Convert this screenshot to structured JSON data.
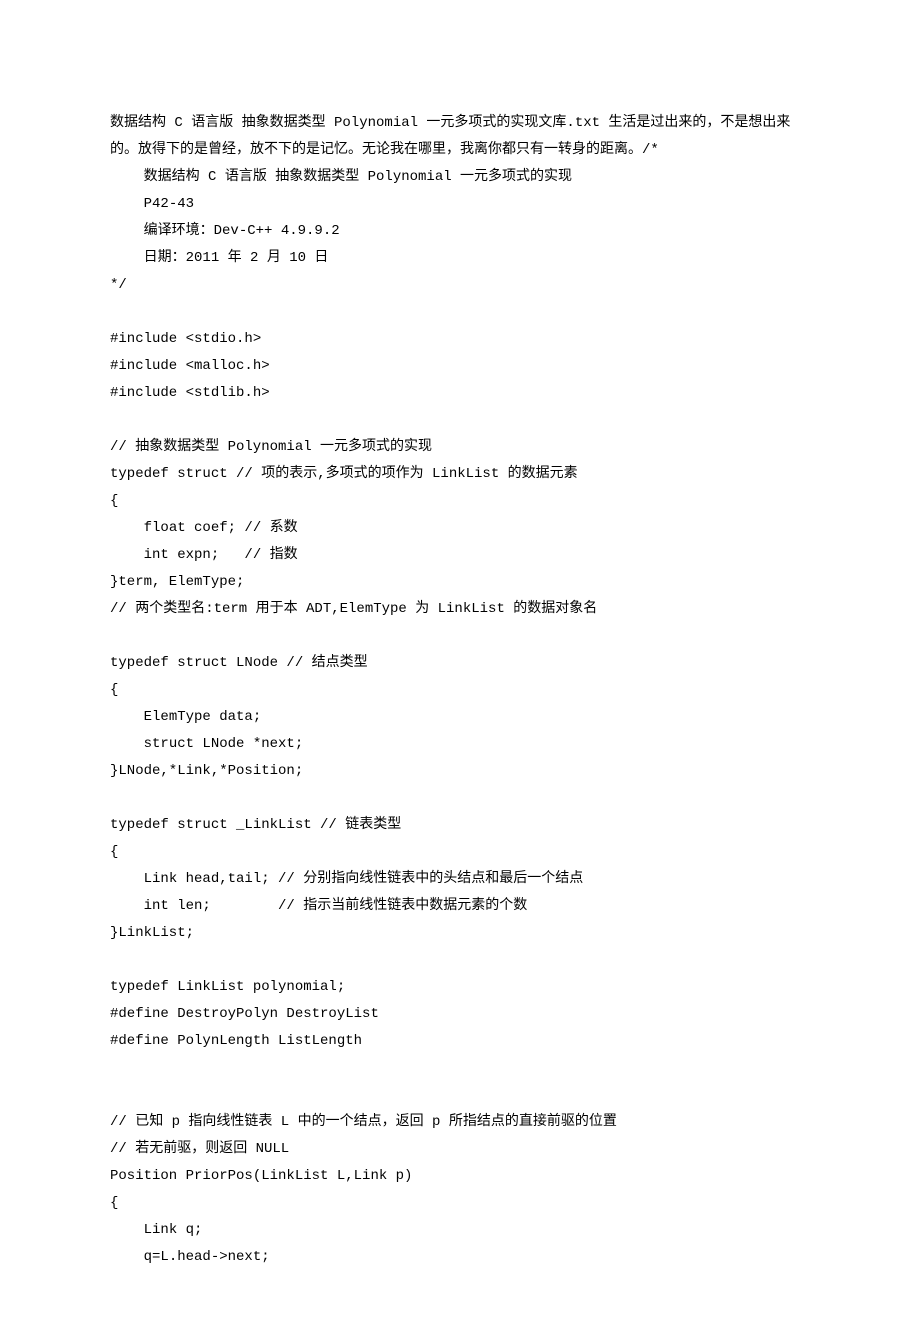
{
  "lines": [
    "数据结构 C 语言版 抽象数据类型 Polynomial 一元多项式的实现文库.txt 生活是过出来的，不是想出来的。放得下的是曾经，放不下的是记忆。无论我在哪里，我离你都只有一转身的距离。/*",
    "    数据结构 C 语言版 抽象数据类型 Polynomial 一元多项式的实现",
    "    P42-43",
    "    编译环境：Dev-C++ 4.9.9.2",
    "    日期：2011 年 2 月 10 日",
    "*/",
    "",
    "#include <stdio.h>",
    "#include <malloc.h>",
    "#include <stdlib.h>",
    "",
    "// 抽象数据类型 Polynomial 一元多项式的实现",
    "typedef struct // 项的表示,多项式的项作为 LinkList 的数据元素",
    "{",
    "    float coef; // 系数",
    "    int expn;   // 指数",
    "}term, ElemType;",
    "// 两个类型名:term 用于本 ADT,ElemType 为 LinkList 的数据对象名",
    "",
    "typedef struct LNode // 结点类型",
    "{",
    "    ElemType data;",
    "    struct LNode *next;",
    "}LNode,*Link,*Position;",
    "",
    "typedef struct _LinkList // 链表类型",
    "{",
    "    Link head,tail; // 分别指向线性链表中的头结点和最后一个结点",
    "    int len;        // 指示当前线性链表中数据元素的个数",
    "}LinkList;",
    "",
    "typedef LinkList polynomial;",
    "#define DestroyPolyn DestroyList",
    "#define PolynLength ListLength",
    "",
    "",
    "// 已知 p 指向线性链表 L 中的一个结点，返回 p 所指结点的直接前驱的位置",
    "// 若无前驱，则返回 NULL",
    "Position PriorPos(LinkList L,Link p)",
    "{",
    "    Link q;",
    "    q=L.head->next;"
  ]
}
